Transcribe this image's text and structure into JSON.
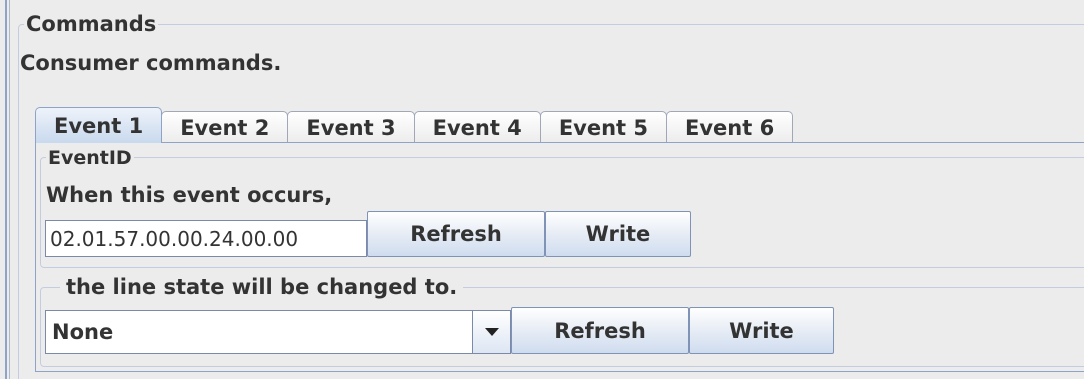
{
  "commands_group": {
    "title": "Commands",
    "description": "Consumer commands."
  },
  "tabs": [
    {
      "label": "Event 1",
      "active": true
    },
    {
      "label": "Event 2",
      "active": false
    },
    {
      "label": "Event 3",
      "active": false
    },
    {
      "label": "Event 4",
      "active": false
    },
    {
      "label": "Event 5",
      "active": false
    },
    {
      "label": "Event 6",
      "active": false
    }
  ],
  "event_id_group": {
    "title": "EventID",
    "prompt": "When this event occurs,",
    "event_id_value": "02.01.57.00.00.24.00.00",
    "refresh_label": "Refresh",
    "write_label": "Write"
  },
  "line_state_group": {
    "title": "the line state will be changed to.",
    "selected_value": "None",
    "refresh_label": "Refresh",
    "write_label": "Write"
  },
  "icons": {
    "dropdown": "chevron-down-icon"
  },
  "colors": {
    "background": "#ececec",
    "border_accent": "#8ea3c7",
    "active_tab": "#c9d9ee"
  }
}
